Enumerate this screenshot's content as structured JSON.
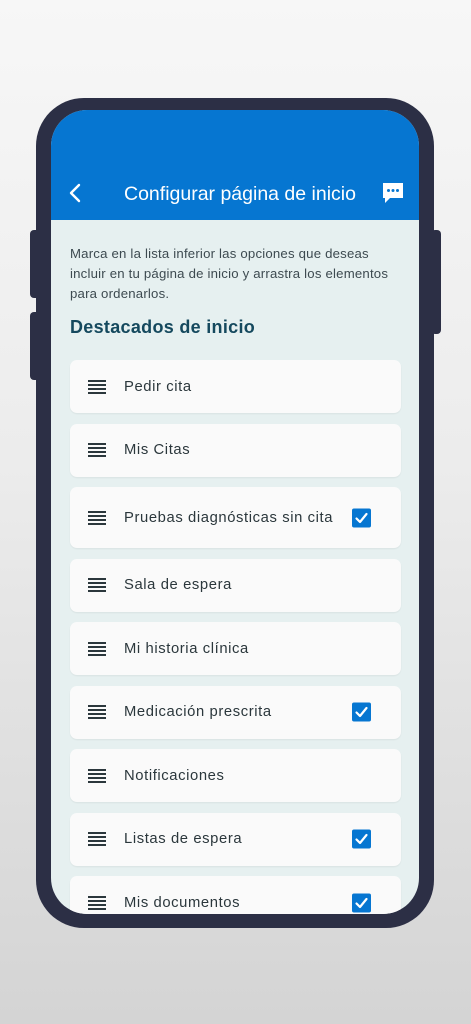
{
  "appbar": {
    "title": "Configurar página de inicio",
    "back_icon": "chevron-left-icon",
    "chat_icon": "chat-bubble-icon"
  },
  "intro_text": "Marca en la lista inferior las opciones que deseas incluir en tu página de inicio y arrastra los elementos para ordenarlos.",
  "section_title": "Destacados de inicio",
  "items": [
    {
      "label": "Pedir cita",
      "checked": false
    },
    {
      "label": "Mis Citas",
      "checked": false
    },
    {
      "label": "Pruebas diagnósticas sin cita",
      "checked": true
    },
    {
      "label": "Sala de espera",
      "checked": false
    },
    {
      "label": "Mi historia clínica",
      "checked": false
    },
    {
      "label": "Medicación prescrita",
      "checked": true
    },
    {
      "label": "Notificaciones",
      "checked": false
    },
    {
      "label": "Listas de espera",
      "checked": true
    },
    {
      "label": "Mis documentos",
      "checked": true
    }
  ],
  "colors": {
    "primary": "#0676d1",
    "background": "#e6f0f0",
    "section_title": "#15495e",
    "card": "#fafafa",
    "phone_frame": "#2c2f45"
  }
}
